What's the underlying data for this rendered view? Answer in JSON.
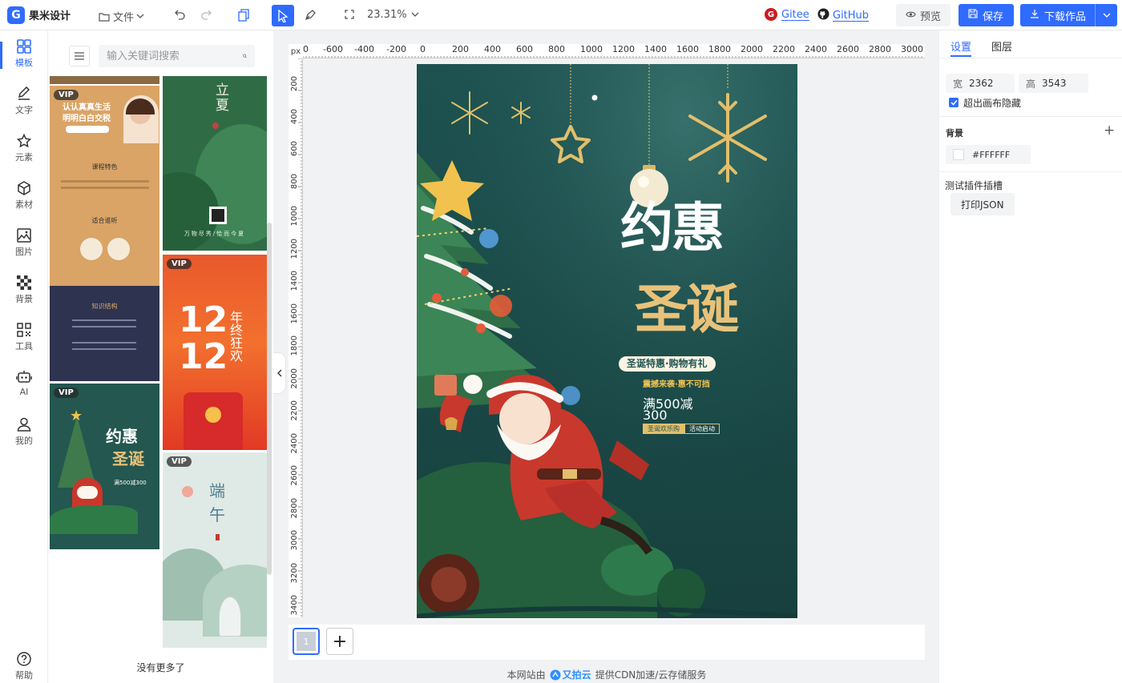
{
  "app": {
    "logo_letter": "G",
    "name": "果米设计"
  },
  "toolbar": {
    "file_label": "文件",
    "zoom": "23.31%",
    "gitee_label": "Gitee",
    "github_label": "GitHub",
    "preview_label": "预览",
    "save_label": "保存",
    "download_label": "下载作品"
  },
  "rail": {
    "items": [
      {
        "label": "模板",
        "icon": "template-icon"
      },
      {
        "label": "文字",
        "icon": "pen-icon"
      },
      {
        "label": "元素",
        "icon": "star-icon"
      },
      {
        "label": "素材",
        "icon": "cube-icon"
      },
      {
        "label": "图片",
        "icon": "image-icon"
      },
      {
        "label": "背景",
        "icon": "checker-icon"
      },
      {
        "label": "工具",
        "icon": "qr-icon"
      },
      {
        "label": "AI",
        "icon": "robot-icon"
      },
      {
        "label": "我的",
        "icon": "user-icon"
      }
    ],
    "help_label": "帮助"
  },
  "templates": {
    "search_placeholder": "输入关键词搜索",
    "vip_badge": "VIP",
    "no_more": "没有更多了",
    "card1": {
      "title_line1": "认认真真生活",
      "title_line2": "明明白白交税",
      "section1": "课程特色",
      "section2": "适合谁听",
      "section3": "知识结构"
    },
    "card2": {
      "title": "立夏",
      "footer": "万物尽秀/恰而今夏"
    },
    "card3": {
      "numbers_top": "12",
      "numbers_bottom": "12",
      "side_text": "年终狂欢"
    },
    "card4": {
      "title1": "约惠",
      "title2": "圣诞",
      "offer": "满500减300"
    },
    "card5": {
      "title1": "端",
      "title2": "午"
    }
  },
  "rulers": {
    "unit": "px",
    "top_labels": [
      "0",
      "-600",
      "-400",
      "-200",
      "0",
      "200",
      "400",
      "600",
      "800",
      "1000",
      "1200",
      "1400",
      "1600",
      "1800",
      "2000",
      "2200",
      "2400",
      "2600",
      "2800",
      "3000"
    ],
    "left_labels": [
      "200",
      "400",
      "600",
      "800",
      "1000",
      "1200",
      "1400",
      "1600",
      "1800",
      "2000",
      "2200",
      "2400",
      "2600",
      "2800",
      "3000",
      "3200",
      "3400"
    ]
  },
  "poster": {
    "title1": "约惠",
    "title2": "圣诞",
    "subtitle": "圣诞特惠·购物有礼",
    "promo_line": "震撼来袭·惠不可挡",
    "offer": "满500减300",
    "tag1": "圣诞欢乐购",
    "tag2": "活动启动",
    "bg_color": "#1F5552"
  },
  "pages": {
    "current": "1"
  },
  "footer": {
    "prefix": "本网站由",
    "brand": "又拍云",
    "suffix": "提供CDN加速/云存储服务"
  },
  "settings": {
    "tab_settings": "设置",
    "tab_layers": "图层",
    "width_label": "宽",
    "width_value": "2362",
    "height_label": "高",
    "height_value": "3543",
    "overflow_label": "超出画布隐藏",
    "overflow_checked": true,
    "background_label": "背景",
    "background_value": "#FFFFFF",
    "plugin_slot_label": "测试插件插槽",
    "print_json_label": "打印JSON"
  }
}
